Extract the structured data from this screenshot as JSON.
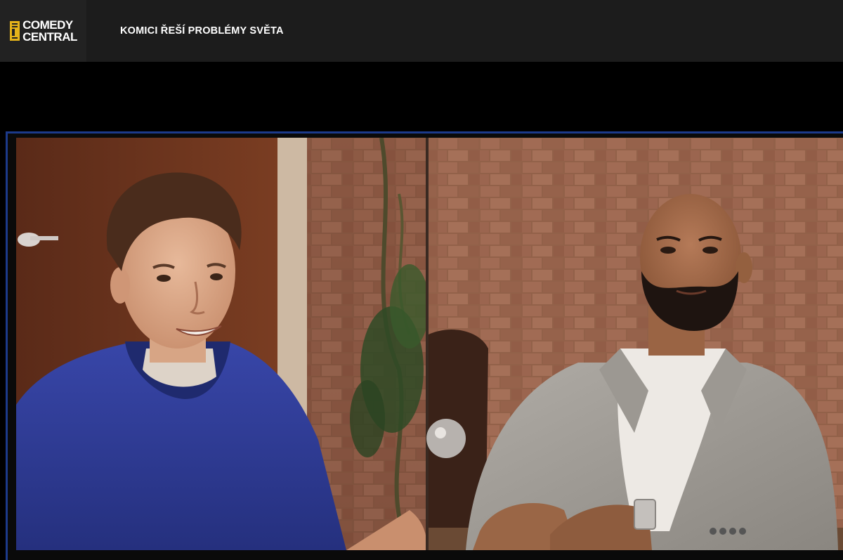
{
  "header": {
    "logo_line1": "COMEDY",
    "logo_line2": "CENTRAL",
    "logo_mark_icon": "comedy-central-c-icon",
    "show_title": "KOMICI ŘEŠÍ PROBLÉMY SVĚTA"
  },
  "player": {
    "content": "video-frame",
    "accent_color": "#1c3a8a"
  },
  "colors": {
    "header_bg": "#1c1c1c",
    "logo_bg": "#222222",
    "logo_accent": "#e5b31a",
    "page_bg": "#000000"
  }
}
